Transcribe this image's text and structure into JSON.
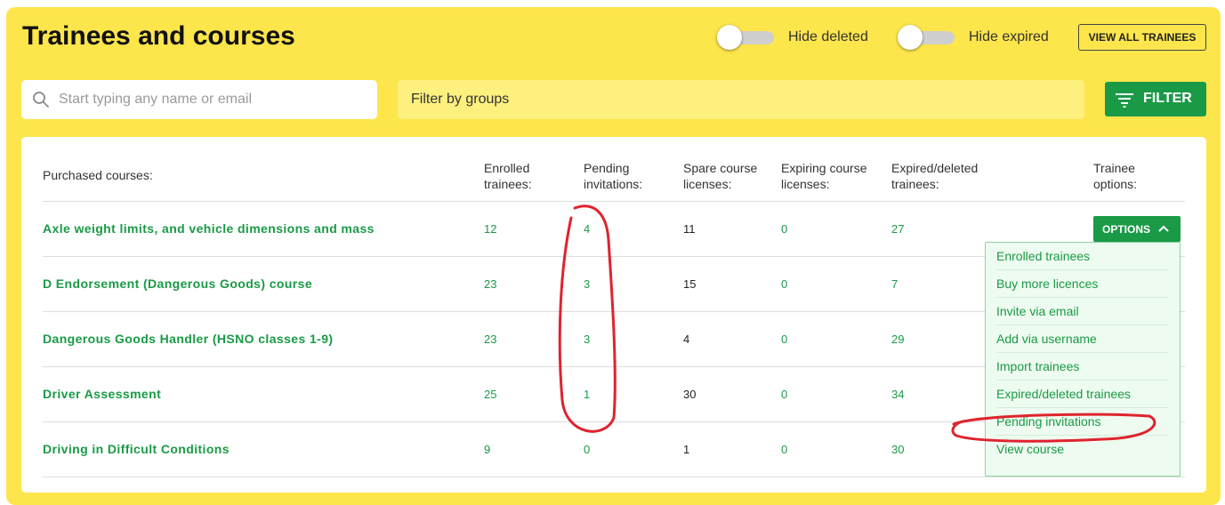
{
  "page": {
    "title": "Trainees and courses"
  },
  "toggles": {
    "hide_deleted": "Hide deleted",
    "hide_expired": "Hide expired"
  },
  "buttons": {
    "view_all": "VIEW ALL TRAINEES",
    "filter": "FILTER",
    "options": "OPTIONS"
  },
  "search": {
    "placeholder": "Start typing any name or email"
  },
  "groups": {
    "placeholder": "Filter by groups"
  },
  "table": {
    "headers": {
      "course": "Purchased courses:",
      "enrolled": "Enrolled\ntrainees:",
      "pending": "Pending\ninvitations:",
      "spare": "Spare course\nlicenses:",
      "expiring": "Expiring course\nlicenses:",
      "expired": "Expired/deleted\ntrainees:",
      "options": "Trainee\noptions:"
    },
    "rows": [
      {
        "course": "Axle weight limits, and vehicle dimensions and mass",
        "enrolled": "12",
        "pending": "4",
        "spare": "11",
        "expiring": "0",
        "expired": "27"
      },
      {
        "course": "D Endorsement (Dangerous Goods) course",
        "enrolled": "23",
        "pending": "3",
        "spare": "15",
        "expiring": "0",
        "expired": "7"
      },
      {
        "course": "Dangerous Goods Handler (HSNO classes 1-9)",
        "enrolled": "23",
        "pending": "3",
        "spare": "4",
        "expiring": "0",
        "expired": "29"
      },
      {
        "course": "Driver Assessment",
        "enrolled": "25",
        "pending": "1",
        "spare": "30",
        "expiring": "0",
        "expired": "34"
      },
      {
        "course": "Driving in Difficult Conditions",
        "enrolled": "9",
        "pending": "0",
        "spare": "1",
        "expiring": "0",
        "expired": "30"
      }
    ]
  },
  "options_menu": {
    "items": [
      "Enrolled trainees",
      "Buy more licences",
      "Invite via email",
      "Add via username",
      "Import trainees",
      "Expired/deleted trainees",
      "Pending invitations",
      "View course"
    ]
  },
  "colors": {
    "background": "#fde54c",
    "accent_green": "#1a9a46",
    "annotation_red": "#e0232e"
  }
}
